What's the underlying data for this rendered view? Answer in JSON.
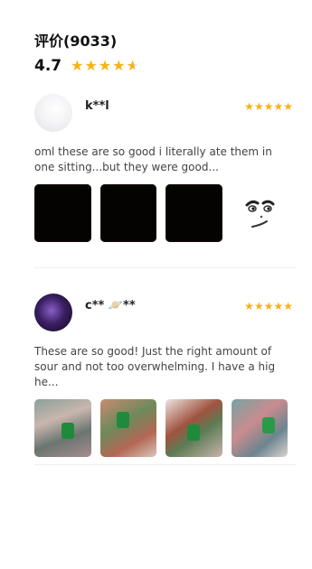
{
  "header": {
    "title": "评价(9033)"
  },
  "rating": {
    "value": "4.7",
    "stars": 4.6
  },
  "reviews": [
    {
      "user": "k**l",
      "stars": 5,
      "text": "oml these are so good i literally ate them in one sitting...but they were good...",
      "photos": [
        "dark",
        "dark",
        "dark",
        "sticker"
      ]
    },
    {
      "user": "c** 🪐**",
      "stars": 5,
      "text": "These are so good! Just the right amount of sour and not too overwhelming. I have a highe...",
      "photos": [
        "candy",
        "candy",
        "candy",
        "candy"
      ]
    }
  ],
  "colors": {
    "star": "#f5b316",
    "avatar_2": "#5a3a8f"
  },
  "icons": {
    "star": "star-icon",
    "sticker": "face-sticker-icon"
  }
}
